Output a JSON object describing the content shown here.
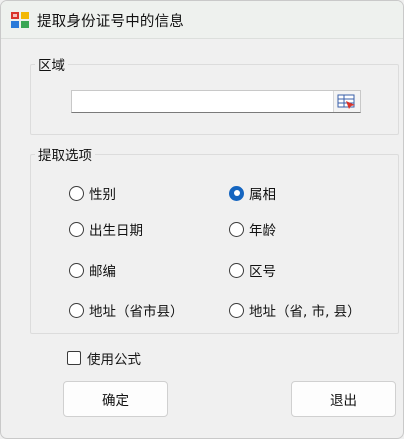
{
  "window": {
    "title": "提取身份证号中的信息"
  },
  "region_group": {
    "legend": "区域",
    "input_value": ""
  },
  "options_group": {
    "legend": "提取选项",
    "options": [
      {
        "label": "性别",
        "checked": false
      },
      {
        "label": "属相",
        "checked": true
      },
      {
        "label": "出生日期",
        "checked": false
      },
      {
        "label": "年龄",
        "checked": false
      },
      {
        "label": "邮编",
        "checked": false
      },
      {
        "label": "区号",
        "checked": false
      },
      {
        "label": "地址（省市县）",
        "checked": false
      },
      {
        "label": "地址（省, 市, 县）",
        "checked": false
      }
    ]
  },
  "use_formula": {
    "label": "使用公式",
    "checked": false
  },
  "buttons": {
    "ok": "确定",
    "exit": "退出"
  },
  "colors": {
    "accent": "#1565c0",
    "background": "#f0f0f0"
  },
  "icons": {
    "app": "app-grid-icon",
    "range_select": "range-select-icon"
  }
}
